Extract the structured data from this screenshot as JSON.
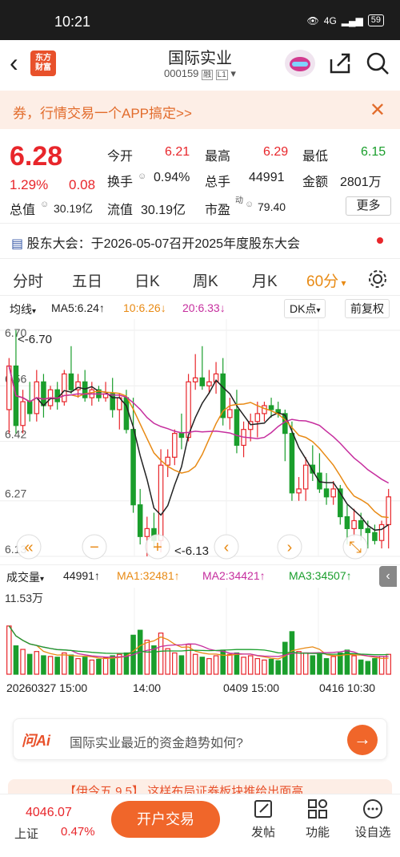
{
  "status_bar": {
    "time": "10:21",
    "network": "4G",
    "battery": "59"
  },
  "header": {
    "back_icon": "chevron-left",
    "logo_text_1": "东方",
    "logo_text_2": "财富",
    "stock_name": "国际实业",
    "stock_code": "000159",
    "tag_margin": "融",
    "tag_level": "L1"
  },
  "banner": {
    "text": "券，行情交易一个APP搞定>>"
  },
  "quote": {
    "price": "6.28",
    "change_pct": "1.29%",
    "change": "0.08",
    "open_label": "今开",
    "open": "6.21",
    "high_label": "最高",
    "high": "6.29",
    "low_label": "最低",
    "low": "6.15",
    "turnover_label": "换手",
    "turnover": "0.94%",
    "volume_label": "总手",
    "volume": "44991",
    "amount_label": "金额",
    "amount": "2801万",
    "total_mv_label": "总值",
    "total_mv": "30.19亿",
    "float_mv_label": "流值",
    "float_mv": "30.19亿",
    "pe_label": "市盈",
    "pe_super": "动",
    "pe": "79.40",
    "more_label": "更多"
  },
  "meeting": {
    "label": "股东大会：",
    "text": "于2026-05-07召开2025年度股东大会"
  },
  "period_tabs": [
    "分时",
    "五日",
    "日K",
    "周K",
    "月K",
    "60分"
  ],
  "active_tab": "60分",
  "chart_toolbar": {
    "ma_select": "均线",
    "ma5": "MA5:6.24↑",
    "ma10": "10:6.26↓",
    "ma20": "20:6.33↓",
    "dk_button": "DK点",
    "adjust_button": "前复权"
  },
  "volume_toolbar": {
    "select": "成交量",
    "value": "44991↑",
    "ma1": "MA1:32481↑",
    "ma2": "MA2:34421↑",
    "ma3": "MA3:34507↑",
    "max_label": "11.53万"
  },
  "colors": {
    "up": "#e8262b",
    "down": "#1a9e2c",
    "ma5": "#222222",
    "ma10": "#e88a14",
    "ma20": "#c62e9e"
  },
  "chart_data": {
    "type": "candlestick",
    "y_ticks": [
      "6.70",
      "6.56",
      "6.42",
      "6.27",
      "6.13"
    ],
    "ylim": [
      6.13,
      6.7
    ],
    "annotations": {
      "high": "<-6.70",
      "low": "<-6.13"
    },
    "x_labels": [
      "20260327 15:00",
      "14:00",
      "0409 15:00",
      "0416 10:30"
    ],
    "candles": [
      {
        "o": 6.5,
        "h": 6.63,
        "l": 6.44,
        "c": 6.61
      },
      {
        "o": 6.61,
        "h": 6.7,
        "l": 6.44,
        "c": 6.46
      },
      {
        "o": 6.46,
        "h": 6.55,
        "l": 6.44,
        "c": 6.52
      },
      {
        "o": 6.52,
        "h": 6.57,
        "l": 6.47,
        "c": 6.49
      },
      {
        "o": 6.49,
        "h": 6.6,
        "l": 6.47,
        "c": 6.57
      },
      {
        "o": 6.57,
        "h": 6.59,
        "l": 6.48,
        "c": 6.51
      },
      {
        "o": 6.51,
        "h": 6.56,
        "l": 6.5,
        "c": 6.55
      },
      {
        "o": 6.55,
        "h": 6.57,
        "l": 6.5,
        "c": 6.52
      },
      {
        "o": 6.52,
        "h": 6.6,
        "l": 6.51,
        "c": 6.59
      },
      {
        "o": 6.59,
        "h": 6.66,
        "l": 6.54,
        "c": 6.55
      },
      {
        "o": 6.55,
        "h": 6.59,
        "l": 6.53,
        "c": 6.57
      },
      {
        "o": 6.57,
        "h": 6.6,
        "l": 6.52,
        "c": 6.53
      },
      {
        "o": 6.53,
        "h": 6.57,
        "l": 6.51,
        "c": 6.55
      },
      {
        "o": 6.55,
        "h": 6.56,
        "l": 6.52,
        "c": 6.53
      },
      {
        "o": 6.53,
        "h": 6.57,
        "l": 6.52,
        "c": 6.54
      },
      {
        "o": 6.54,
        "h": 6.58,
        "l": 6.48,
        "c": 6.5
      },
      {
        "o": 6.5,
        "h": 6.54,
        "l": 6.45,
        "c": 6.53
      },
      {
        "o": 6.53,
        "h": 6.55,
        "l": 6.44,
        "c": 6.45
      },
      {
        "o": 6.45,
        "h": 6.53,
        "l": 6.24,
        "c": 6.26
      },
      {
        "o": 6.26,
        "h": 6.3,
        "l": 6.16,
        "c": 6.18
      },
      {
        "o": 6.18,
        "h": 6.23,
        "l": 6.13,
        "c": 6.2
      },
      {
        "o": 6.2,
        "h": 6.24,
        "l": 6.15,
        "c": 6.17
      },
      {
        "o": 6.17,
        "h": 6.4,
        "l": 6.14,
        "c": 6.36
      },
      {
        "o": 6.36,
        "h": 6.4,
        "l": 6.33,
        "c": 6.38
      },
      {
        "o": 6.38,
        "h": 6.45,
        "l": 6.36,
        "c": 6.44
      },
      {
        "o": 6.44,
        "h": 6.49,
        "l": 6.4,
        "c": 6.43
      },
      {
        "o": 6.43,
        "h": 6.59,
        "l": 6.42,
        "c": 6.57
      },
      {
        "o": 6.57,
        "h": 6.64,
        "l": 6.55,
        "c": 6.58
      },
      {
        "o": 6.58,
        "h": 6.66,
        "l": 6.55,
        "c": 6.56
      },
      {
        "o": 6.56,
        "h": 6.6,
        "l": 6.54,
        "c": 6.57
      },
      {
        "o": 6.57,
        "h": 6.62,
        "l": 6.54,
        "c": 6.59
      },
      {
        "o": 6.59,
        "h": 6.63,
        "l": 6.46,
        "c": 6.48
      },
      {
        "o": 6.48,
        "h": 6.53,
        "l": 6.45,
        "c": 6.5
      },
      {
        "o": 6.5,
        "h": 6.55,
        "l": 6.39,
        "c": 6.41
      },
      {
        "o": 6.41,
        "h": 6.47,
        "l": 6.38,
        "c": 6.45
      },
      {
        "o": 6.45,
        "h": 6.49,
        "l": 6.42,
        "c": 6.47
      },
      {
        "o": 6.47,
        "h": 6.52,
        "l": 6.43,
        "c": 6.49
      },
      {
        "o": 6.49,
        "h": 6.52,
        "l": 6.47,
        "c": 6.51
      },
      {
        "o": 6.51,
        "h": 6.53,
        "l": 6.48,
        "c": 6.5
      },
      {
        "o": 6.5,
        "h": 6.52,
        "l": 6.48,
        "c": 6.49
      },
      {
        "o": 6.49,
        "h": 6.5,
        "l": 6.37,
        "c": 6.44
      },
      {
        "o": 6.44,
        "h": 6.47,
        "l": 6.27,
        "c": 6.29
      },
      {
        "o": 6.29,
        "h": 6.33,
        "l": 6.27,
        "c": 6.3
      },
      {
        "o": 6.3,
        "h": 6.38,
        "l": 6.27,
        "c": 6.36
      },
      {
        "o": 6.36,
        "h": 6.41,
        "l": 6.32,
        "c": 6.34
      },
      {
        "o": 6.34,
        "h": 6.39,
        "l": 6.29,
        "c": 6.3
      },
      {
        "o": 6.3,
        "h": 6.34,
        "l": 6.26,
        "c": 6.28
      },
      {
        "o": 6.28,
        "h": 6.32,
        "l": 6.26,
        "c": 6.3
      },
      {
        "o": 6.3,
        "h": 6.31,
        "l": 6.21,
        "c": 6.23
      },
      {
        "o": 6.23,
        "h": 6.26,
        "l": 6.16,
        "c": 6.2
      },
      {
        "o": 6.2,
        "h": 6.25,
        "l": 6.18,
        "c": 6.22
      },
      {
        "o": 6.22,
        "h": 6.24,
        "l": 6.17,
        "c": 6.2
      },
      {
        "o": 6.2,
        "h": 6.22,
        "l": 6.15,
        "c": 6.19
      },
      {
        "o": 6.19,
        "h": 6.21,
        "l": 6.16,
        "c": 6.17
      },
      {
        "o": 6.17,
        "h": 6.22,
        "l": 6.15,
        "c": 6.21
      },
      {
        "o": 6.21,
        "h": 6.3,
        "l": 6.15,
        "c": 6.28
      }
    ],
    "volumes": [
      68,
      40,
      35,
      28,
      32,
      26,
      25,
      24,
      30,
      27,
      22,
      24,
      20,
      21,
      23,
      26,
      28,
      30,
      55,
      62,
      48,
      40,
      58,
      36,
      30,
      26,
      42,
      28,
      24,
      22,
      26,
      34,
      28,
      30,
      24,
      26,
      22,
      20,
      21,
      19,
      45,
      60,
      32,
      30,
      26,
      28,
      22,
      25,
      30,
      34,
      26,
      20,
      18,
      22,
      25,
      28
    ]
  },
  "chart_nav": {
    "left": "«",
    "minus": "−",
    "plus": "+",
    "prev": "‹",
    "next": "›",
    "expand": "⤡"
  },
  "ai_box": {
    "logo": "问Ai",
    "question": "国际实业最近的资金趋势如何?"
  },
  "news_peek": "【伊今五 9.5】 这样布局证券板块推给出面高",
  "bottom_bar": {
    "index_value": "4046.07",
    "index_name": "上证",
    "index_change": "0.47%",
    "trade_button": "开户交易",
    "post_label": "发帖",
    "func_label": "功能",
    "pick_label": "设自选"
  }
}
